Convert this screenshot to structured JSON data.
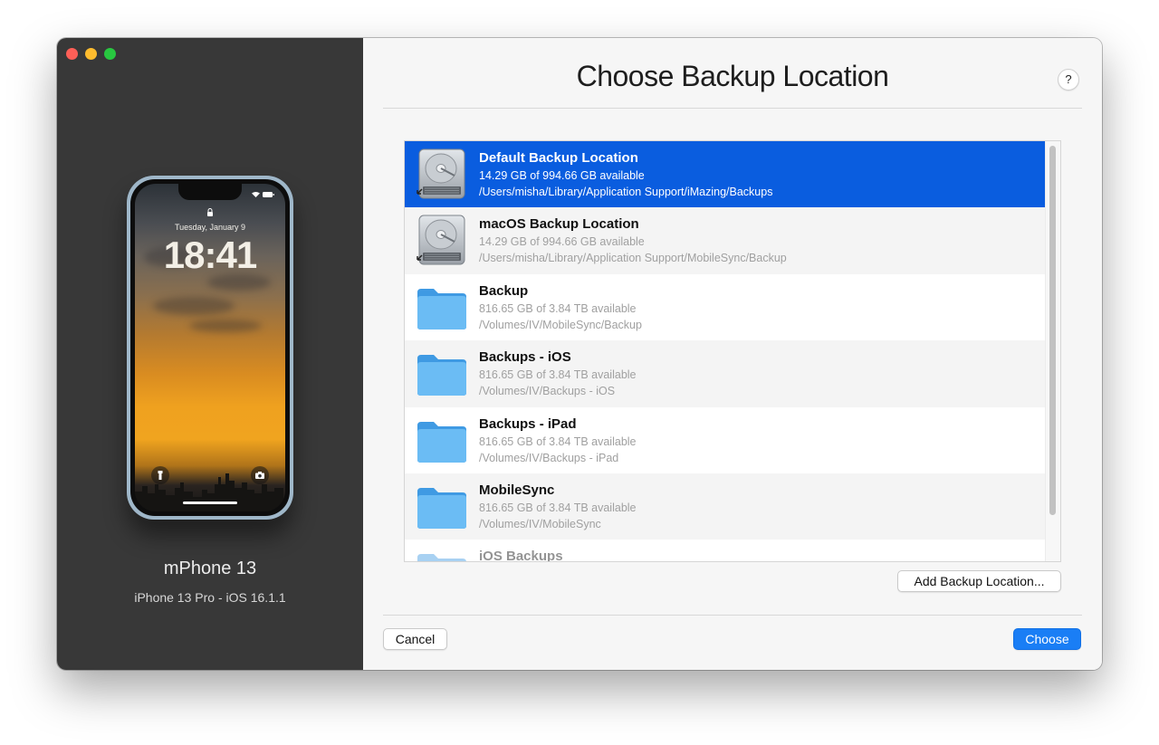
{
  "window": {
    "controls": [
      "close",
      "minimize",
      "maximize"
    ],
    "title_bar_colors": {
      "close": "#fe5f57",
      "minimize": "#febc2e",
      "maximize": "#28c840"
    }
  },
  "device": {
    "lock_screen": {
      "date": "Tuesday, January 9",
      "time": "18:41"
    },
    "name": "mPhone 13",
    "model": "iPhone 13 Pro - iOS 16.1.1"
  },
  "dialog": {
    "title": "Choose Backup Location",
    "help_label": "?",
    "locations": [
      {
        "name": "Default Backup Location",
        "available": "14.29 GB of 994.66 GB available",
        "path": "/Users/misha/Library/Application Support/iMazing/Backups",
        "icon": "hard-drive-icon",
        "selected": true
      },
      {
        "name": "macOS Backup Location",
        "available": "14.29 GB of 994.66 GB available",
        "path": "/Users/misha/Library/Application Support/MobileSync/Backup",
        "icon": "hard-drive-icon",
        "selected": false
      },
      {
        "name": "Backup",
        "available": "816.65 GB of 3.84 TB available",
        "path": "/Volumes/IV/MobileSync/Backup",
        "icon": "folder-icon",
        "selected": false
      },
      {
        "name": "Backups - iOS",
        "available": "816.65 GB of 3.84 TB available",
        "path": "/Volumes/IV/Backups - iOS",
        "icon": "folder-icon",
        "selected": false
      },
      {
        "name": "Backups - iPad",
        "available": "816.65 GB of 3.84 TB available",
        "path": "/Volumes/IV/Backups - iPad",
        "icon": "folder-icon",
        "selected": false
      },
      {
        "name": "MobileSync",
        "available": "816.65 GB of 3.84 TB available",
        "path": "/Volumes/IV/MobileSync",
        "icon": "folder-icon",
        "selected": false
      },
      {
        "name": "iOS Backups",
        "available": "",
        "path": "",
        "icon": "folder-icon",
        "selected": false
      }
    ],
    "add_button": "Add Backup Location...",
    "cancel_button": "Cancel",
    "choose_button": "Choose",
    "accent_color": "#0a5ddf"
  }
}
